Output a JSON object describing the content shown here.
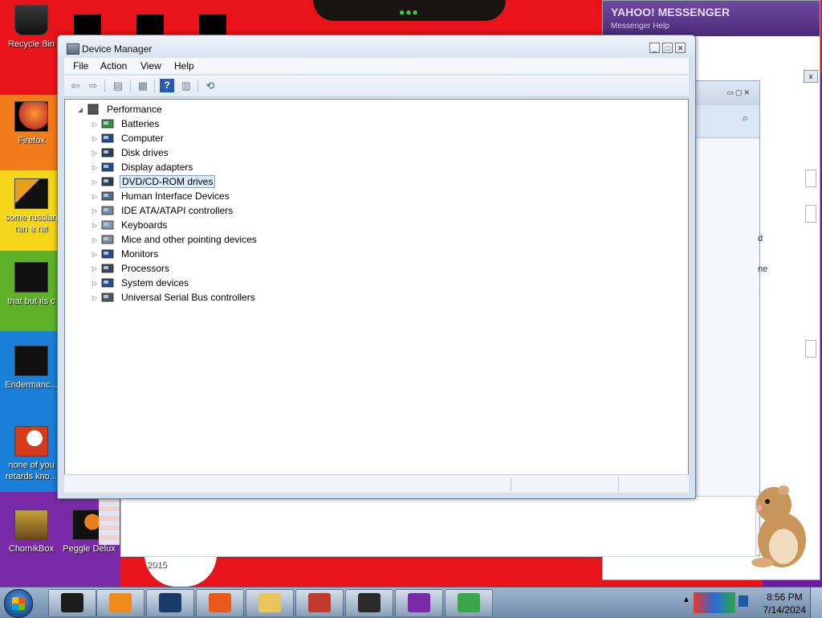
{
  "desktop": {
    "icons": [
      {
        "label": "Recycle Bin"
      },
      {
        "label": "Firefox"
      },
      {
        "label": "some russian ran a rat"
      },
      {
        "label": "that but its c"
      },
      {
        "label": "Endermanc..."
      },
      {
        "label": "none of you retards kno..."
      },
      {
        "label": "ChomikBox"
      },
      {
        "label": "Peggle Delux"
      }
    ],
    "wallpaper_text": "2015"
  },
  "yahoo_messenger": {
    "title": "YAHOO! MESSENGER",
    "menu": "Messenger   Help",
    "side_button": "x",
    "partial_text_1": "d",
    "partial_text_2": "ne"
  },
  "device_manager": {
    "title": "Device Manager",
    "menu": [
      "File",
      "Action",
      "View",
      "Help"
    ],
    "toolbar": [
      {
        "icon": "back-arrow-icon",
        "glyph": "⇦"
      },
      {
        "icon": "forward-arrow-icon",
        "glyph": "⇨"
      },
      {
        "icon": "show-hide-console-tree-icon",
        "glyph": "▤"
      },
      {
        "icon": "properties-icon",
        "glyph": "▦"
      },
      {
        "icon": "help-icon",
        "glyph": "?"
      },
      {
        "icon": "action-pane-icon",
        "glyph": "▥"
      },
      {
        "icon": "scan-hardware-icon",
        "glyph": "⟲"
      }
    ],
    "tree": {
      "root": "Performance",
      "nodes": [
        {
          "label": "Batteries",
          "icon": "battery-icon",
          "color": "#3a8f3a"
        },
        {
          "label": "Computer",
          "icon": "computer-icon",
          "color": "#2a4a8a"
        },
        {
          "label": "Disk drives",
          "icon": "disk-drive-icon",
          "color": "#333f4c"
        },
        {
          "label": "Display adapters",
          "icon": "display-adapter-icon",
          "color": "#2a4a8a"
        },
        {
          "label": "DVD/CD-ROM drives",
          "icon": "dvd-drive-icon",
          "color": "#333f4c",
          "selected": true
        },
        {
          "label": "Human Interface Devices",
          "icon": "hid-icon",
          "color": "#5a6a7a"
        },
        {
          "label": "IDE ATA/ATAPI controllers",
          "icon": "ide-controller-icon",
          "color": "#7a8a9a"
        },
        {
          "label": "Keyboards",
          "icon": "keyboard-icon",
          "color": "#8a9aa8"
        },
        {
          "label": "Mice and other pointing devices",
          "icon": "mouse-icon",
          "color": "#8a8a8a"
        },
        {
          "label": "Monitors",
          "icon": "monitor-icon",
          "color": "#2a4a8a"
        },
        {
          "label": "Processors",
          "icon": "processor-icon",
          "color": "#444"
        },
        {
          "label": "System devices",
          "icon": "system-device-icon",
          "color": "#2a4a8a"
        },
        {
          "label": "Universal Serial Bus controllers",
          "icon": "usb-icon",
          "color": "#555"
        }
      ]
    }
  },
  "taskbar": {
    "apps": [
      {
        "name": "taskbar-app-1",
        "color": "#1c1c1c"
      },
      {
        "name": "taskbar-app-2",
        "color": "#f08a1a"
      },
      {
        "name": "taskbar-app-3",
        "color": "#1a3a6a"
      },
      {
        "name": "taskbar-firefox",
        "color": "#e8591a"
      },
      {
        "name": "taskbar-explorer",
        "color": "#e8c45a"
      },
      {
        "name": "taskbar-device-manager",
        "color": "#c0392b"
      },
      {
        "name": "taskbar-app-7",
        "color": "#2a2a2a"
      },
      {
        "name": "taskbar-yahoo",
        "color": "#7a2aa8"
      },
      {
        "name": "taskbar-bluestacks",
        "color": "#3aa84a"
      }
    ],
    "time": "8:56 PM",
    "date": "7/14/2024"
  }
}
